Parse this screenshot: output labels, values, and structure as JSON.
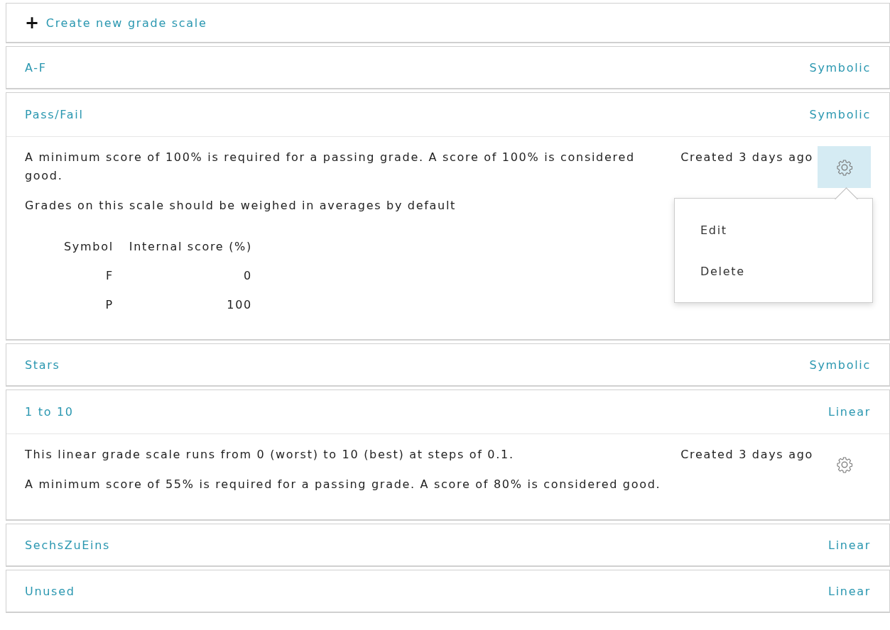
{
  "create_link": {
    "icon": "+",
    "label": "Create new grade scale"
  },
  "scales": [
    {
      "name": "A-F",
      "type": "Symbolic",
      "expanded": false
    },
    {
      "name": "Pass/Fail",
      "type": "Symbolic",
      "expanded": true,
      "paragraphs": [
        "A minimum score of 100% is required for a passing grade. A score of 100% is considered good.",
        "Grades on this scale should be weighed in averages by default"
      ],
      "table": {
        "columns": [
          "Symbol",
          "Internal score (%)"
        ],
        "rows": [
          [
            "F",
            "0"
          ],
          [
            "P",
            "100"
          ]
        ]
      },
      "created": "Created 3 days ago",
      "menu_open": true,
      "menu": [
        "Edit",
        "Delete"
      ]
    },
    {
      "name": "Stars",
      "type": "Symbolic",
      "expanded": false
    },
    {
      "name": "1 to 10",
      "type": "Linear",
      "expanded": true,
      "paragraphs": [
        "This linear grade scale runs from 0 (worst) to 10 (best) at steps of 0.1.",
        "A minimum score of 55% is required for a passing grade. A score of 80% is considered good."
      ],
      "created": "Created 3 days ago",
      "menu_open": false
    },
    {
      "name": "SechsZuEins",
      "type": "Linear",
      "expanded": false
    },
    {
      "name": "Unused",
      "type": "Linear",
      "expanded": false
    }
  ]
}
